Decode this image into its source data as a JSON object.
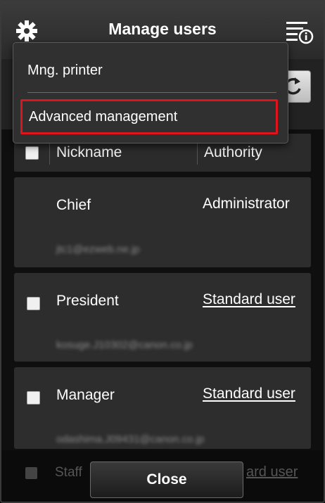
{
  "header": {
    "title": "Manage users",
    "settings_icon": "gear-icon",
    "menu_icon": "menu-info-icon"
  },
  "menu": {
    "items": [
      {
        "label": "Mng. printer"
      },
      {
        "label": "Advanced management",
        "highlighted": true
      }
    ],
    "highlight_color": "#e0141b"
  },
  "table": {
    "columns": {
      "nickname": "Nickname",
      "authority": "Authority"
    },
    "rows": [
      {
        "nickname": "Chief",
        "authority": "Administrator",
        "email": "jtc1@ezweb.ne.jp",
        "has_checkbox": false,
        "authority_is_link": false
      },
      {
        "nickname": "President",
        "authority": "Standard user",
        "email": "kosuge.J10302@canon.co.jp",
        "has_checkbox": true,
        "authority_is_link": true
      },
      {
        "nickname": "Manager",
        "authority": "Standard user",
        "email": "odashima.J09431@canon.co.jp",
        "has_checkbox": true,
        "authority_is_link": true
      }
    ],
    "partial_row": {
      "nickname": "Staff",
      "authority_fragment": "ard user"
    }
  },
  "footer": {
    "close_label": "Close"
  }
}
